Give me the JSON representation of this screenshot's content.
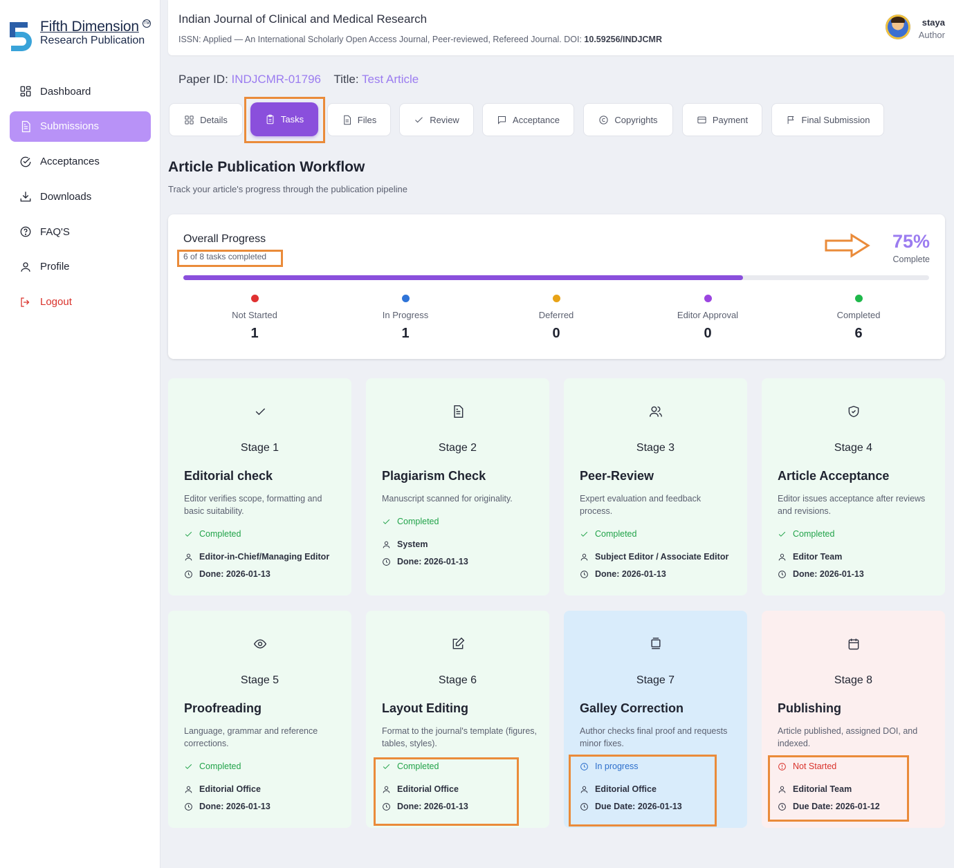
{
  "brand": {
    "line1": "Fifth Dimension",
    "line2": "Research Publication",
    "tm": "TM"
  },
  "sidebar": {
    "items": [
      {
        "label": "Dashboard",
        "icon": "dashboard-icon"
      },
      {
        "label": "Submissions",
        "icon": "document-icon",
        "active": true
      },
      {
        "label": "Acceptances",
        "icon": "check-circle-icon"
      },
      {
        "label": "Downloads",
        "icon": "download-icon"
      },
      {
        "label": "FAQ'S",
        "icon": "help-circle-icon"
      },
      {
        "label": "Profile",
        "icon": "user-icon"
      },
      {
        "label": "Logout",
        "icon": "logout-icon"
      }
    ]
  },
  "header": {
    "journal_title": "Indian Journal of Clinical and Medical Research",
    "journal_subtitle": "ISSN: Applied — An International Scholarly Open Access Journal, Peer-reviewed, Refereed Journal. DOI: ",
    "doi": "10.59256/INDJCMR",
    "user_name": "staya",
    "user_role": "Author"
  },
  "paper": {
    "id_label": "Paper ID:",
    "id_value": "INDJCMR-01796",
    "title_label": "Title:",
    "title_value": "Test Article"
  },
  "tabs": [
    {
      "label": "Details",
      "icon": "grid-icon"
    },
    {
      "label": "Tasks",
      "icon": "clipboard-icon",
      "active": true
    },
    {
      "label": "Files",
      "icon": "file-icon"
    },
    {
      "label": "Review",
      "icon": "check-icon"
    },
    {
      "label": "Acceptance",
      "icon": "message-icon"
    },
    {
      "label": "Copyrights",
      "icon": "copyright-icon"
    },
    {
      "label": "Payment",
      "icon": "card-icon"
    },
    {
      "label": "Final Submission",
      "icon": "flag-icon"
    }
  ],
  "workflow": {
    "title": "Article Publication Workflow",
    "subtitle": "Track your article's progress through the publication pipeline"
  },
  "overall": {
    "title": "Overall Progress",
    "count_text": "6 of 8 tasks completed",
    "percent_text": "75%",
    "percent": 75,
    "complete_label": "Complete",
    "legend": [
      {
        "label": "Not Started",
        "count": "1",
        "color": "#e03131"
      },
      {
        "label": "In Progress",
        "count": "1",
        "color": "#2f74d8"
      },
      {
        "label": "Deferred",
        "count": "0",
        "color": "#e8a317"
      },
      {
        "label": "Editor Approval",
        "count": "0",
        "color": "#9b45e0"
      },
      {
        "label": "Completed",
        "count": "6",
        "color": "#1fb84b"
      }
    ]
  },
  "stages": [
    {
      "num": "Stage 1",
      "name": "Editorial check",
      "desc": "Editor verifies scope, formatting and basic suitability.",
      "status": "Completed",
      "owner": "Editor-in-Chief/Managing Editor",
      "date": "Done: 2026-01-13",
      "icon": "check-icon"
    },
    {
      "num": "Stage 2",
      "name": "Plagiarism Check",
      "desc": "Manuscript scanned for originality.",
      "status": "Completed",
      "owner": "System",
      "date": "Done: 2026-01-13",
      "icon": "document-icon"
    },
    {
      "num": "Stage 3",
      "name": "Peer-Review",
      "desc": "Expert evaluation and feedback process.",
      "status": "Completed",
      "owner": "Subject Editor / Associate Editor",
      "date": "Done: 2026-01-13",
      "icon": "users-icon"
    },
    {
      "num": "Stage 4",
      "name": "Article Acceptance",
      "desc": "Editor issues acceptance after reviews and revisions.",
      "status": "Completed",
      "owner": "Editor Team",
      "date": "Done: 2026-01-13",
      "icon": "shield-check-icon"
    },
    {
      "num": "Stage 5",
      "name": "Proofreading",
      "desc": "Language, grammar and reference corrections.",
      "status": "Completed",
      "owner": "Editorial Office",
      "date": "Done: 2026-01-13",
      "icon": "eye-icon"
    },
    {
      "num": "Stage 6",
      "name": "Layout Editing",
      "desc": "Format to the journal's template (figures, tables, styles).",
      "status": "Completed",
      "owner": "Editorial Office",
      "date": "Done: 2026-01-13",
      "icon": "edit-icon"
    },
    {
      "num": "Stage 7",
      "name": "Galley Correction",
      "desc": "Author checks final proof and requests minor fixes.",
      "status": "In progress",
      "owner": "Editorial Office",
      "date": "Due Date: 2026-01-13",
      "icon": "layers-icon"
    },
    {
      "num": "Stage 8",
      "name": "Publishing",
      "desc": "Article published, assigned DOI, and indexed.",
      "status": "Not Started",
      "owner": "Editorial Team",
      "date": "Due Date: 2026-01-12",
      "icon": "calendar-icon"
    }
  ],
  "colors": {
    "accent": "#8a4fdc",
    "accent_light": "#b892f7",
    "highlight": "#ea8b3a",
    "completed": "#22a34a",
    "in_progress": "#2c6ecb",
    "not_started": "#d9322b"
  }
}
